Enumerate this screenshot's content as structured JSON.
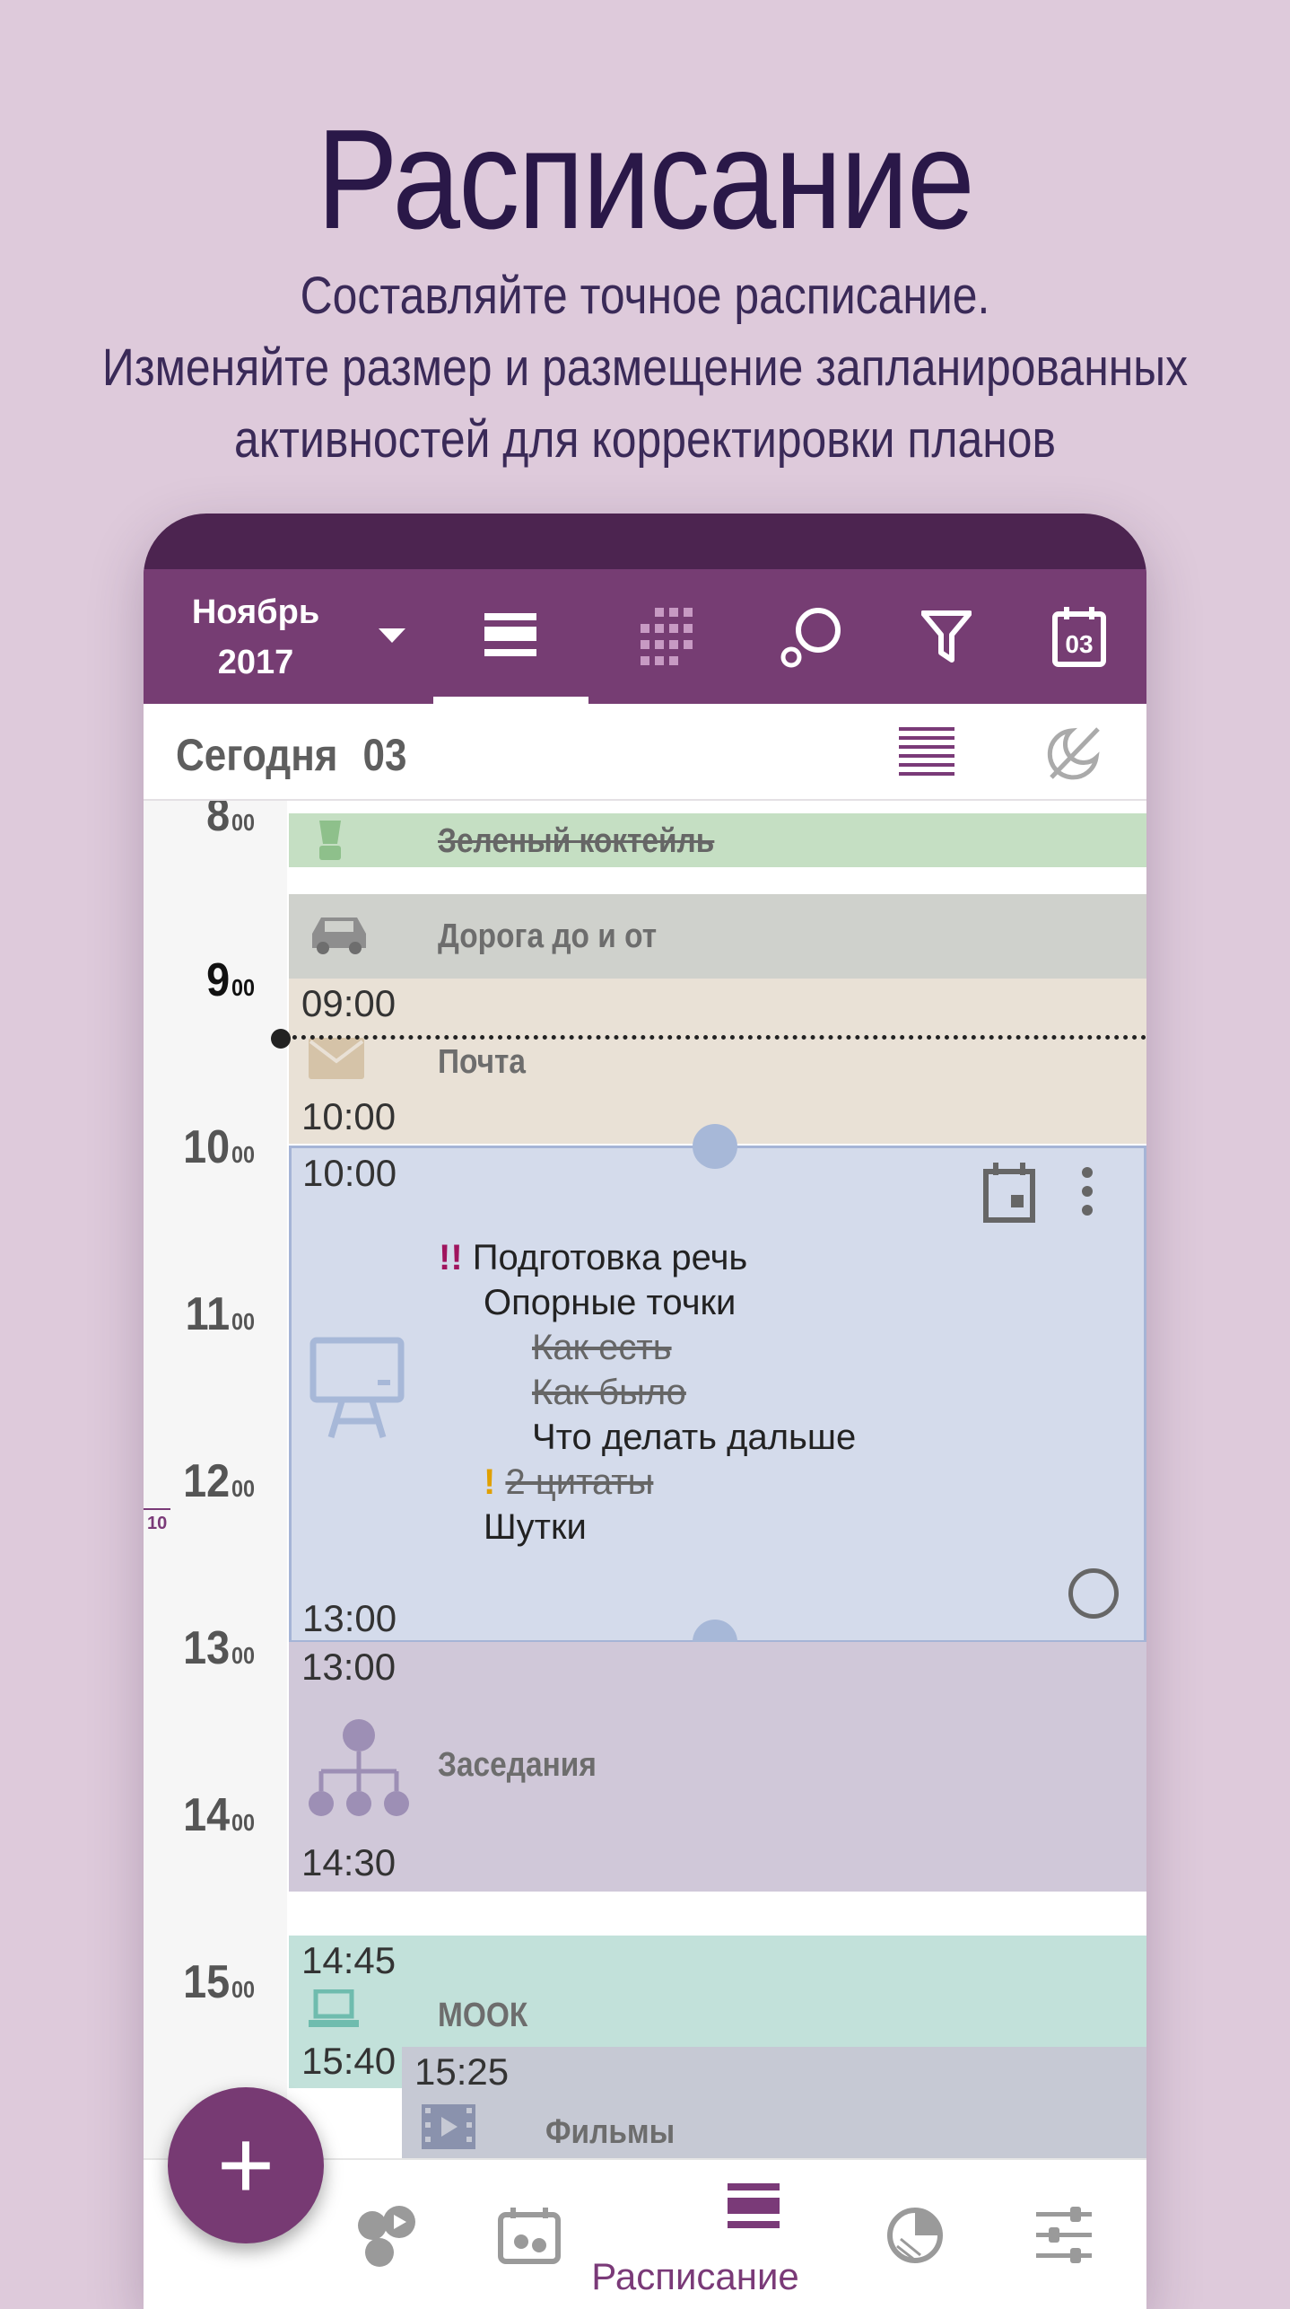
{
  "headline": {
    "title": "Расписание",
    "line1": "Составляйте точное расписание.",
    "line2": "Изменяйте размер и размещение запланированных",
    "line3": "активностей для корректировки планов"
  },
  "appbar": {
    "month": "Ноябрь",
    "year": "2017",
    "calendar_day": "03",
    "icons": [
      "dropdown-caret-icon",
      "list-view-icon",
      "grid-view-icon",
      "search-icon",
      "filter-icon",
      "today-calendar-icon"
    ]
  },
  "subbar": {
    "today_label": "Сегодня",
    "today_day": "03"
  },
  "hours": [
    {
      "h": "8",
      "m": "00"
    },
    {
      "h": "9",
      "m": "00"
    },
    {
      "h": "10",
      "m": "00"
    },
    {
      "h": "11",
      "m": "00"
    },
    {
      "h": "12",
      "m": "00"
    },
    {
      "h": "13",
      "m": "00"
    },
    {
      "h": "14",
      "m": "00"
    },
    {
      "h": "15",
      "m": "00"
    }
  ],
  "side_marker": "10",
  "events": {
    "green": {
      "title": "Зеленый коктейль",
      "color": "#c5dfc3"
    },
    "road": {
      "title": "Дорога до и от",
      "color": "#cfd1cc"
    },
    "mail": {
      "title": "Почта",
      "start": "09:00",
      "end": "10:00",
      "color": "#e9e1d6"
    },
    "speech": {
      "start": "10:00",
      "end": "13:00",
      "color": "#d4dbeb",
      "priority": "!!",
      "title": "Подготовка речь",
      "items": [
        {
          "text": "Опорные точки",
          "done": false
        },
        {
          "text": "Как есть",
          "done": true
        },
        {
          "text": "Как было",
          "done": true
        },
        {
          "text": "Что делать дальше",
          "done": false
        },
        {
          "text": "2 цитаты",
          "done": true,
          "priority": "!"
        },
        {
          "text": "Шутки",
          "done": false
        }
      ]
    },
    "meeting": {
      "title": "Заседания",
      "start": "13:00",
      "end": "14:30",
      "color": "#d0c8d9"
    },
    "mook": {
      "title": "МООК",
      "start": "14:45",
      "end": "15:40",
      "color": "#c2e1da"
    },
    "films": {
      "title": "Фильмы",
      "start": "15:25",
      "color": "#c6c9d4"
    }
  },
  "bottomnav": {
    "active_label": "Расписание"
  },
  "fab": {
    "label": "+"
  }
}
